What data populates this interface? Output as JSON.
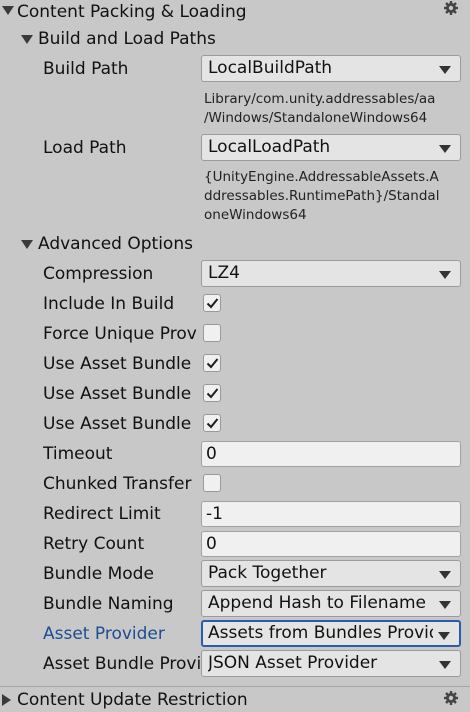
{
  "section": {
    "title": "Content Packing & Loading",
    "next_title": "Content Update Restriction"
  },
  "build_load_paths": {
    "title": "Build and Load Paths",
    "build_path": {
      "label": "Build Path",
      "value": "LocalBuildPath",
      "resolved_lines": [
        "Library/com.unity.addressables/aa",
        "/Windows/StandaloneWindows64"
      ]
    },
    "load_path": {
      "label": "Load Path",
      "value": "LocalLoadPath",
      "resolved_lines": [
        "{UnityEngine.AddressableAssets.A",
        "ddressables.RuntimePath}/Standal",
        "oneWindows64"
      ]
    }
  },
  "advanced": {
    "title": "Advanced Options",
    "compression": {
      "label": "Compression",
      "value": "LZ4"
    },
    "include_in_build": {
      "label": "Include In Build",
      "checked": true
    },
    "force_unique_provider": {
      "label": "Force Unique Provider",
      "checked": false
    },
    "use_asset_bundle_1": {
      "label": "Use Asset Bundle Cache",
      "checked": true
    },
    "use_asset_bundle_2": {
      "label": "Use Asset Bundle Crc",
      "checked": true
    },
    "use_asset_bundle_3": {
      "label": "Use Asset Bundle Crc For Cached Bundles",
      "checked": true
    },
    "timeout": {
      "label": "Timeout",
      "value": "0"
    },
    "chunked_transfer": {
      "label": "Chunked Transfer",
      "checked": false
    },
    "redirect_limit": {
      "label": "Redirect Limit",
      "value": "-1"
    },
    "retry_count": {
      "label": "Retry Count",
      "value": "0"
    },
    "bundle_mode": {
      "label": "Bundle Mode",
      "value": "Pack Together"
    },
    "bundle_naming": {
      "label": "Bundle Naming",
      "value": "Append Hash to Filename"
    },
    "asset_provider": {
      "label": "Asset Provider",
      "value": "Assets from Bundles Provider"
    },
    "asset_bundle_provider": {
      "label": "Asset Bundle Provider",
      "value": "JSON Asset Provider"
    }
  },
  "colors": {
    "background": "#c8c8c8",
    "focus": "#2a5ca8",
    "focused_label": "#1c4c93"
  },
  "icons": {
    "section_gear": "gear-icon",
    "check": "checkmark-icon"
  }
}
